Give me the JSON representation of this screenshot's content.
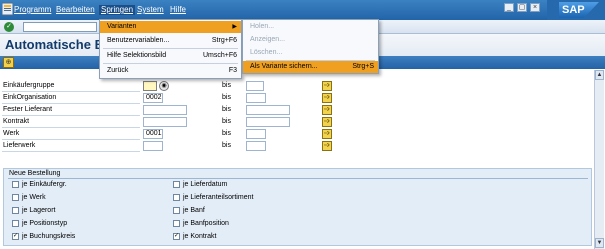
{
  "menubar": {
    "items": [
      "Programm",
      "Bearbeiten",
      "Springen",
      "System",
      "Hilfe"
    ],
    "active_index": 2,
    "brand": "SAP"
  },
  "window_buttons": [
    "_",
    "▢",
    "×"
  ],
  "title": "Automatische Beste",
  "form": {
    "rows": [
      {
        "label": "Einkäufergruppe",
        "from": "",
        "to": ""
      },
      {
        "label": "EinkOrganisation",
        "from": "0002",
        "to": ""
      },
      {
        "label": "Fester Lieferant",
        "from": "",
        "to": ""
      },
      {
        "label": "Kontrakt",
        "from": "",
        "to": ""
      },
      {
        "label": "Werk",
        "from": "0001",
        "to": ""
      },
      {
        "label": "Lieferwerk",
        "from": "",
        "to": ""
      }
    ],
    "bis_label": "bis"
  },
  "group": {
    "title": "Neue Bestellung",
    "left": [
      {
        "label": "je Einkäufergr.",
        "checked": false
      },
      {
        "label": "je Werk",
        "checked": false
      },
      {
        "label": "je Lagerort",
        "checked": false
      },
      {
        "label": "je Positionstyp",
        "checked": false
      },
      {
        "label": "je Buchungskreis",
        "checked": true
      }
    ],
    "right": [
      {
        "label": "je Lieferdatum",
        "checked": false
      },
      {
        "label": "je Lieferanteilsortiment",
        "checked": false
      },
      {
        "label": "je Banf",
        "checked": false
      },
      {
        "label": "je Banfposition",
        "checked": false
      },
      {
        "label": "je Kontrakt",
        "checked": true
      }
    ]
  },
  "springen_menu": {
    "items": [
      {
        "label": "Varianten",
        "shortcut": "",
        "submenu": true
      },
      {
        "label": "Benutzervariablen...",
        "shortcut": "Strg+F6"
      },
      {
        "label": "Hilfe Selektionsbild",
        "shortcut": "Umsch+F6"
      },
      {
        "label": "Zurück",
        "shortcut": "F3"
      }
    ]
  },
  "varianten_menu": {
    "items": [
      {
        "label": "Holen...",
        "disabled": true
      },
      {
        "label": "Anzeigen...",
        "disabled": true
      },
      {
        "label": "Löschen...",
        "disabled": true
      },
      {
        "label": "Als Variante sichern...",
        "shortcut": "Strg+S",
        "disabled": false
      }
    ]
  },
  "colors": {
    "menubar": "#2264a8",
    "highlight": "#f0a020",
    "group_bg": "#e3edf7"
  }
}
